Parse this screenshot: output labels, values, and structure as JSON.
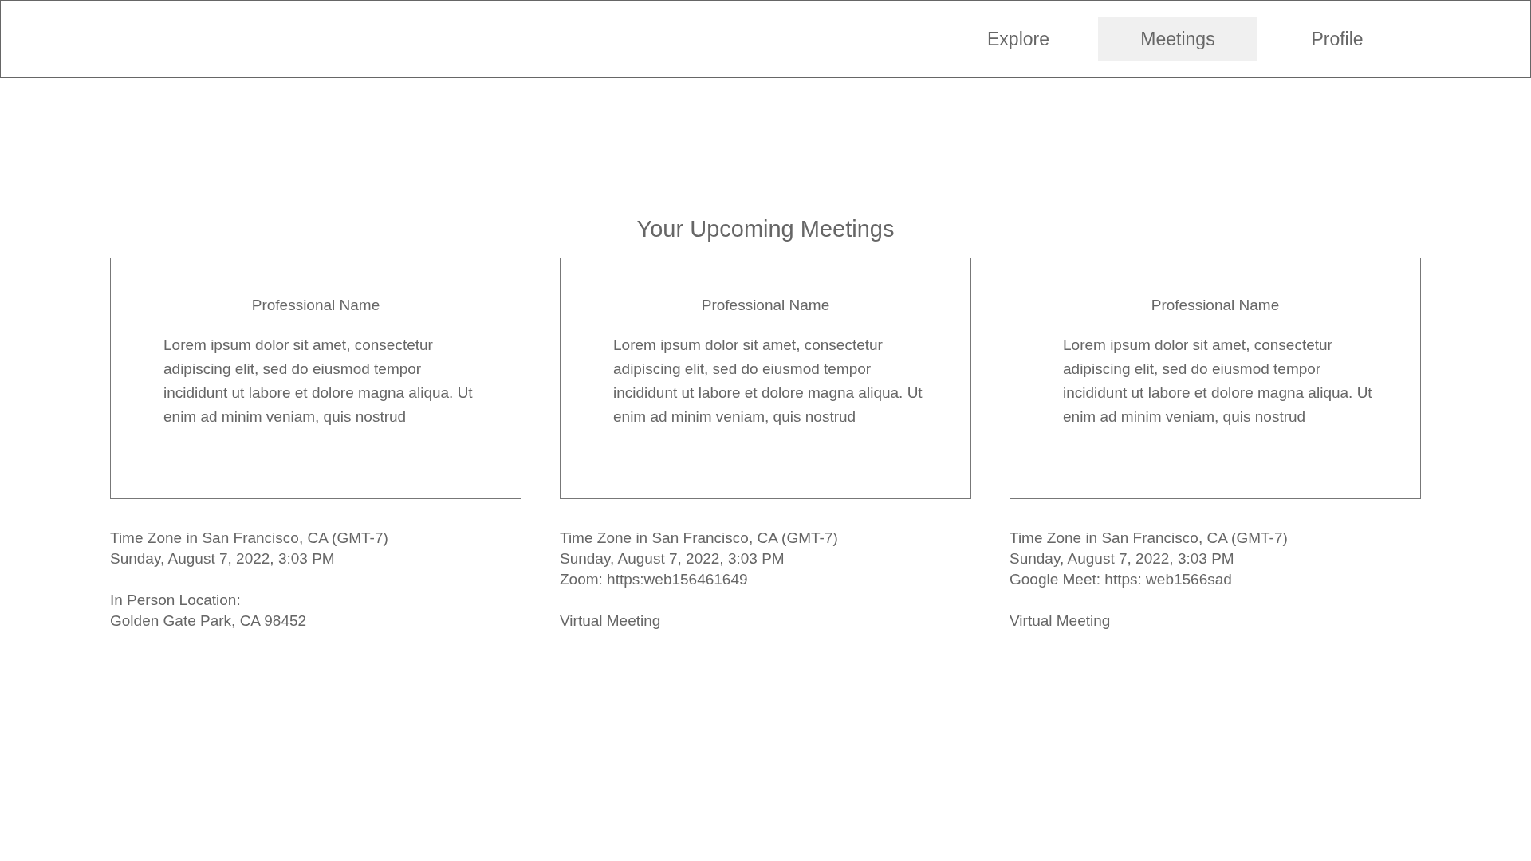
{
  "nav": {
    "tabs": [
      {
        "label": "Explore",
        "selected": false
      },
      {
        "label": "Meetings",
        "selected": true
      },
      {
        "label": "Profile",
        "selected": false
      }
    ]
  },
  "heading": "Your Upcoming Meetings",
  "meetings": [
    {
      "name": "Professional Name",
      "description": "Lorem ipsum dolor sit amet, consectetur adipiscing elit, sed do eiusmod tempor incididunt ut labore et dolore magna aliqua. Ut enim ad minim veniam, quis nostrud",
      "details": [
        [
          "Time Zone in San Francisco, CA (GMT-7)",
          "Sunday, August 7, 2022, 3:03 PM"
        ],
        [
          "In Person Location:",
          "Golden Gate Park, CA 98452"
        ]
      ]
    },
    {
      "name": "Professional Name",
      "description": "Lorem ipsum dolor sit amet, consectetur adipiscing elit, sed do eiusmod tempor incididunt ut labore et dolore magna aliqua. Ut enim ad minim veniam, quis nostrud",
      "details": [
        [
          "Time Zone in San Francisco, CA (GMT-7)",
          "Sunday, August 7, 2022, 3:03 PM",
          "Zoom: https:web156461649"
        ],
        [
          "Virtual Meeting"
        ]
      ]
    },
    {
      "name": "Professional Name",
      "description": "Lorem ipsum dolor sit amet, consectetur adipiscing elit, sed do eiusmod tempor incididunt ut labore et dolore magna aliqua. Ut enim ad minim veniam, quis nostrud",
      "details": [
        [
          "Time Zone in San Francisco, CA (GMT-7)",
          "Sunday, August 7, 2022, 3:03 PM",
          "Google Meet: https: web1566sad"
        ],
        [
          "Virtual Meeting"
        ]
      ]
    }
  ]
}
